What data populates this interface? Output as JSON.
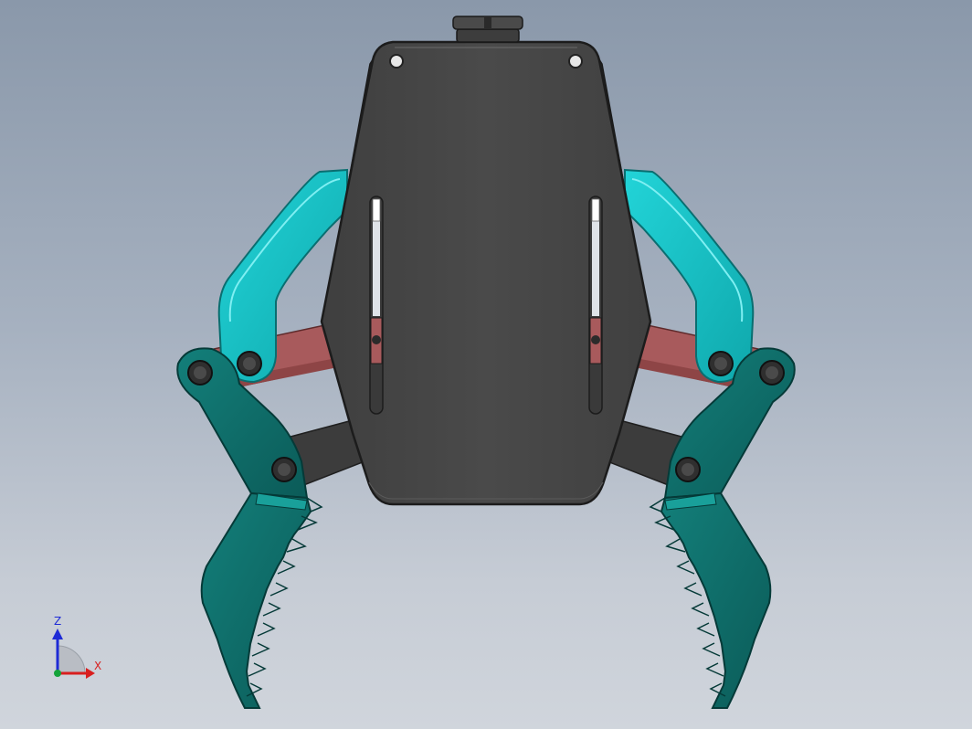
{
  "viewport": {
    "background_top": "#8a98aa",
    "background_bottom": "#d0d5dc"
  },
  "model": {
    "colors": {
      "body_plate": "#474747",
      "body_edge": "#2a2a2a",
      "upper_link": "#17c2c6",
      "lower_link": "#a85a5c",
      "jaw": "#0f6e6a",
      "rear_link": "#3a3a3a",
      "pin": "#3b3b3b"
    }
  },
  "triad": {
    "z_label": "Z",
    "x_label": "X",
    "z_color": "#1e2bd6",
    "x_color": "#d81f1f",
    "y_color": "#14a33a"
  }
}
